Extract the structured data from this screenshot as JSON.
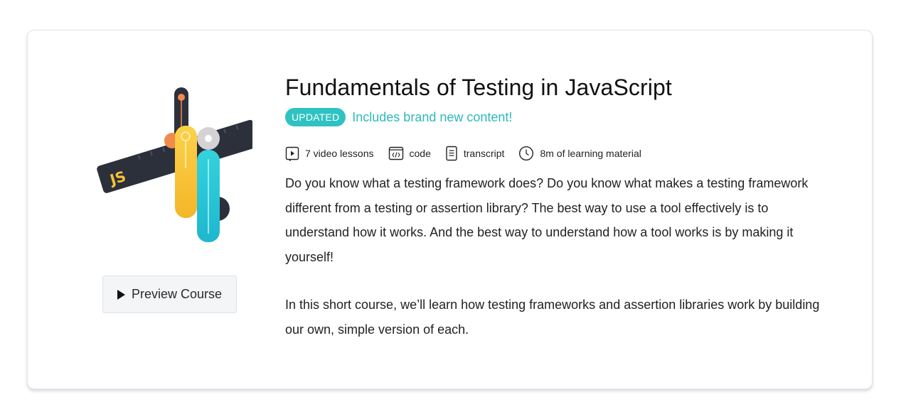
{
  "course": {
    "title": "Fundamentals of Testing in JavaScript",
    "badge": "UPDATED",
    "updated_text": "Includes brand new content!",
    "meta": [
      {
        "icon": "video-icon",
        "label": "7 video lessons"
      },
      {
        "icon": "code-icon",
        "label": "code"
      },
      {
        "icon": "transcript-icon",
        "label": "transcript"
      },
      {
        "icon": "clock-icon",
        "label": "8m of learning material"
      }
    ],
    "description_1": "Do you know what a testing framework does? Do you know what makes a testing framework different from a testing or assertion library? The best way to use a tool effectively is to understand how it works. And the best way to understand how a tool works is by making it yourself!",
    "description_2": "In this short course, we’ll learn how testing frameworks and assertion libraries work by building our own, simple version of each.",
    "logo_text": "JS"
  },
  "preview": {
    "label": "Preview Course",
    "icon": "play-icon"
  },
  "colors": {
    "accent_teal": "#2fc2c2",
    "yellow": "#f8c234",
    "cyan": "#2cc7d6",
    "dark": "#2c303b",
    "orange": "#f28a4c"
  }
}
